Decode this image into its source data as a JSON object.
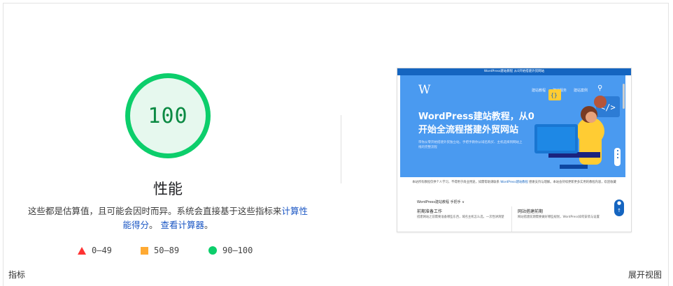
{
  "score": {
    "value": "100",
    "title": "性能",
    "color": "#0cce6b"
  },
  "description": {
    "text": "这些都是估算值，且可能会因时而异。系统会直接基于这些指标来",
    "link1": "计算性能得分",
    "sep": "。",
    "link2": "查看计算器",
    "end": "。"
  },
  "legend": [
    {
      "label": "0–49",
      "shape": "triangle",
      "color": "#ff3333"
    },
    {
      "label": "50–89",
      "shape": "square",
      "color": "#ffaa33"
    },
    {
      "label": "90–100",
      "shape": "circle",
      "color": "#0cce6b"
    }
  ],
  "footer": {
    "left": "指标",
    "right": "展开视图"
  },
  "thumbnail": {
    "topbar": "WordPress建站教程 从0开始搭建外贸网站",
    "logo": "W",
    "nav": [
      "建站教程",
      "建站服务",
      "建站案例"
    ],
    "headline_line1": "WordPress建站教程，从0",
    "headline_line2": "开始全流程搭建外贸网站",
    "subtext": "带你从零开始搭建外贸独立站，手把手教你从域名购买、主机选择到网站上线的完整流程",
    "notice_pre": "本站所有教程仅供个人学习，不得用于商业用途，如需帮助请联系 ",
    "notice_link": "WordPress建站教程",
    "notice_post": " 感谢支持与理解。本站会持续更新更多实用的教程内容，欢迎收藏",
    "section": "WordPress建站教程 手把手 ∨",
    "col1_title": "前期准备工作",
    "col1_text": "搭建网站之前需要准备哪些东西，域名主机怎么选，一次性讲清楚",
    "col2_title": "网站搭建前期",
    "col2_text": "网站搭建前期需要做好哪些规划，WordPress如何安装与设置",
    "colors": {
      "topbar": "#1565c0",
      "hero": "#4a9af0"
    }
  }
}
